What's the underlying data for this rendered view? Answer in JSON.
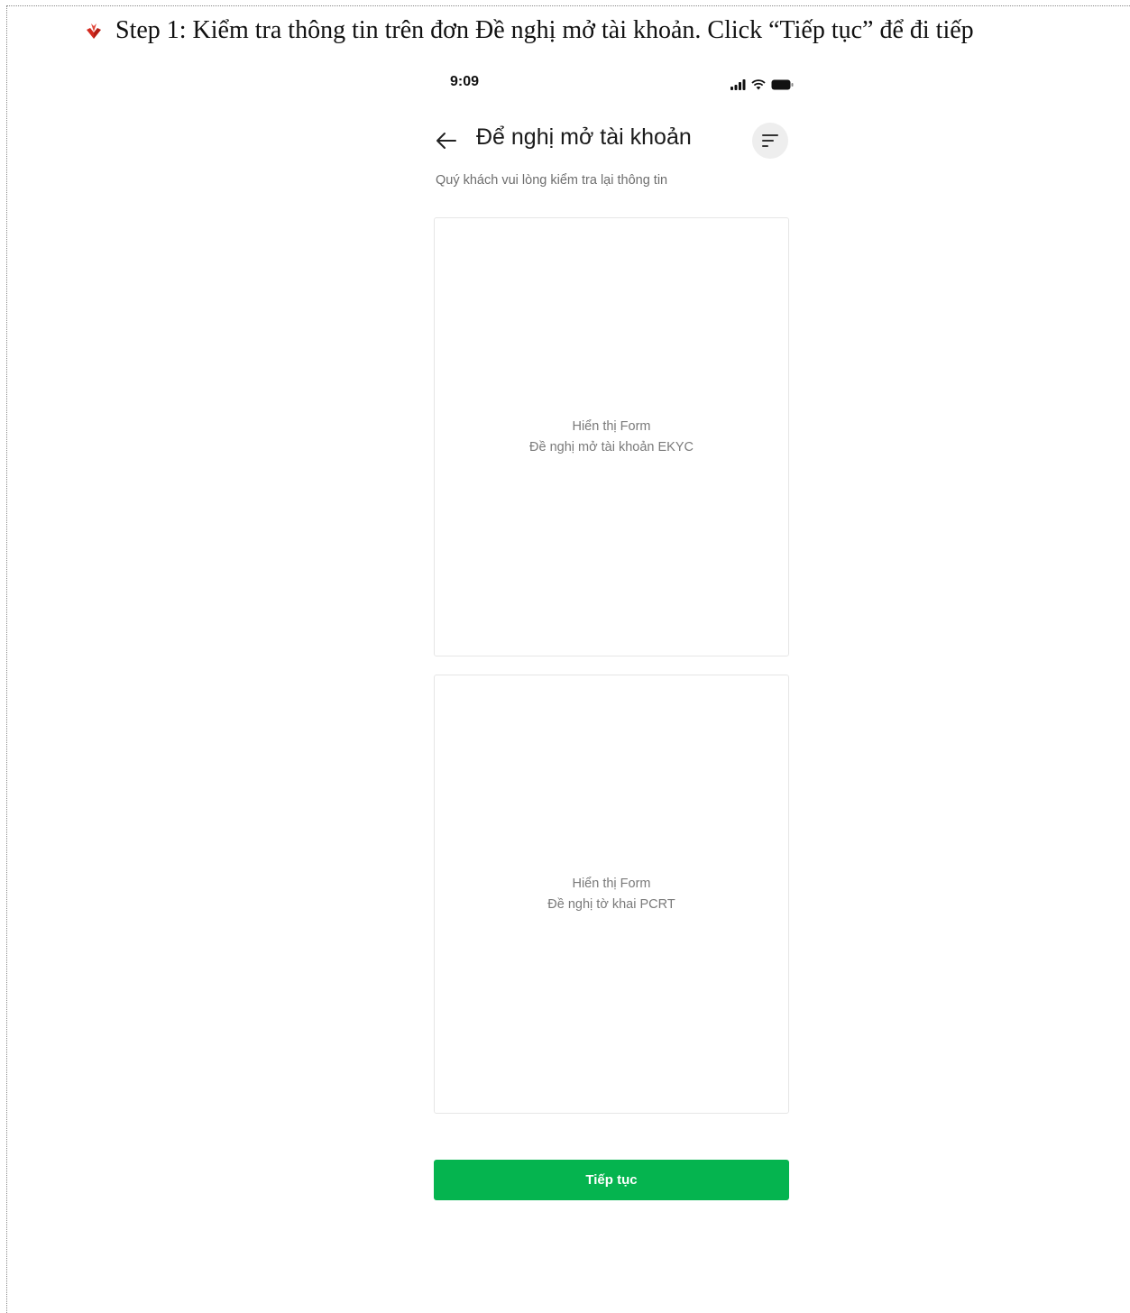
{
  "document": {
    "step_text": "Step 1: Kiểm tra thông tin trên đơn Đề nghị mở tài khoản. Click “Tiếp tục” để đi tiếp",
    "bullet_icon": "red-arrow-bullet-icon",
    "accent_color": "#d42a1f"
  },
  "status_bar": {
    "time": "9:09",
    "icons": [
      "signal-icon",
      "wifi-icon",
      "battery-icon"
    ]
  },
  "header": {
    "title": "Để nghị mở tài khoản",
    "back_icon": "back-arrow-icon",
    "menu_icon": "menu-lines-icon"
  },
  "subtitle": "Quý khách vui lòng kiểm tra lại thông tin",
  "forms": [
    {
      "line1": "Hiển thị Form",
      "line2": "Đề nghị mở tài khoản EKYC"
    },
    {
      "line1": "Hiển thị Form",
      "line2": "Đề nghị tờ khai PCRT"
    }
  ],
  "continue_button": {
    "label": "Tiếp tục",
    "color": "#05b44f"
  }
}
